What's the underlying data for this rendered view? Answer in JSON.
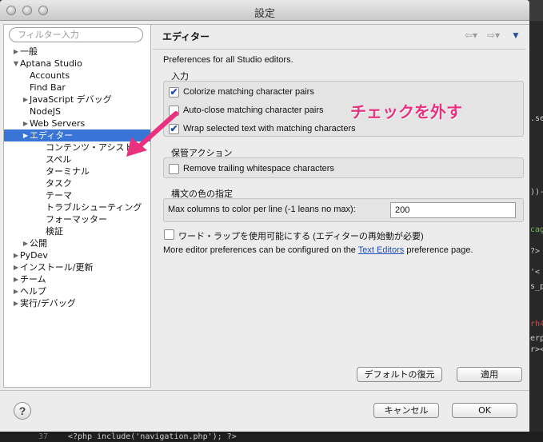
{
  "window": {
    "title": "設定"
  },
  "sidebar": {
    "filter_placeholder": "フィルター入力",
    "items": [
      {
        "label": "一般",
        "twisty": "▶"
      },
      {
        "label": "Aptana Studio",
        "twisty": "▼"
      },
      {
        "label": "Accounts",
        "twisty": ""
      },
      {
        "label": "Find Bar",
        "twisty": ""
      },
      {
        "label": "JavaScript デバッグ",
        "twisty": "▶"
      },
      {
        "label": "NodeJS",
        "twisty": ""
      },
      {
        "label": "Web Servers",
        "twisty": "▶"
      },
      {
        "label": "エディター",
        "twisty": "▶"
      },
      {
        "label": "コンテンツ・アシスト",
        "twisty": ""
      },
      {
        "label": "スペル",
        "twisty": ""
      },
      {
        "label": "ターミナル",
        "twisty": ""
      },
      {
        "label": "タスク",
        "twisty": ""
      },
      {
        "label": "テーマ",
        "twisty": ""
      },
      {
        "label": "トラブルシューティング",
        "twisty": ""
      },
      {
        "label": "フォーマッター",
        "twisty": ""
      },
      {
        "label": "検証",
        "twisty": ""
      },
      {
        "label": "公開",
        "twisty": "▶"
      },
      {
        "label": "PyDev",
        "twisty": "▶"
      },
      {
        "label": "インストール/更新",
        "twisty": "▶"
      },
      {
        "label": "チーム",
        "twisty": "▶"
      },
      {
        "label": "ヘルプ",
        "twisty": "▶"
      },
      {
        "label": "実行/デバッグ",
        "twisty": "▶"
      }
    ],
    "selected": "エディター"
  },
  "main": {
    "title": "エディター",
    "intro": "Preferences for all Studio editors.",
    "input_group": {
      "label": "入力",
      "options": [
        {
          "label": "Colorize matching character pairs",
          "checked": true
        },
        {
          "label": "Auto-close matching character pairs",
          "checked": false
        },
        {
          "label": "Wrap selected text with matching characters",
          "checked": true
        }
      ]
    },
    "save_group": {
      "label": "保管アクション",
      "options": [
        {
          "label": "Remove trailing whitespace characters",
          "checked": false
        }
      ]
    },
    "syntax_group": {
      "label": "構文の色の指定",
      "field_label": "Max columns to color per line (-1 leans no max):",
      "field_value": "200"
    },
    "word_wrap_label": "ワード・ラップを使用可能にする (エディターの再始動が必要)",
    "more_prefix": "More editor preferences can be configured on the",
    "more_link": "Text Editors",
    "more_suffix": "preference page.",
    "restore_defaults": "デフォルトの復元",
    "apply": "適用"
  },
  "footer": {
    "cancel": "キャンセル",
    "ok": "OK",
    "help": "?"
  },
  "annotation": {
    "text": "チェックを外す",
    "color": "#e8327f"
  },
  "background_code": {
    "fragments": [
      ".se",
      "))-",
      "cag",
      "?>",
      "'<",
      "s_p",
      "rh4",
      "erp",
      "r><"
    ],
    "bottom_line": "<?php include('navigation.php'); ?>",
    "line_number": "37"
  }
}
